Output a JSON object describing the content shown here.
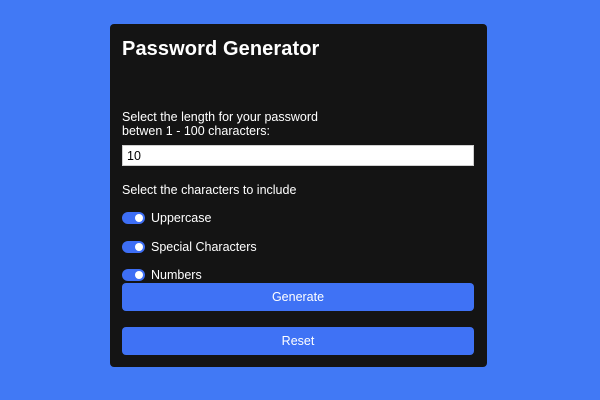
{
  "title": "Password Generator",
  "length": {
    "label_line1": "Select the length for your password",
    "label_line2": "betwen 1 - 100 characters:",
    "value": "10"
  },
  "characters": {
    "label": "Select the characters to include",
    "options": [
      {
        "label": "Uppercase",
        "enabled": true
      },
      {
        "label": "Special Characters",
        "enabled": true
      },
      {
        "label": "Numbers",
        "enabled": true
      }
    ]
  },
  "buttons": {
    "generate": "Generate",
    "reset": "Reset"
  },
  "colors": {
    "background": "#4179f5",
    "card": "#141414",
    "accent": "#3f72f5"
  }
}
